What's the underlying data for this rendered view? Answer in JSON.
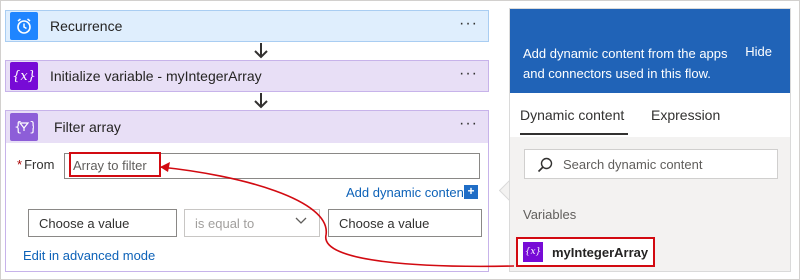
{
  "flow": {
    "recurrence_title": "Recurrence",
    "init_title": "Initialize variable - myIntegerArray",
    "filter_title": "Filter array",
    "more_label": "···",
    "from_label": "From",
    "required_mark": "*",
    "from_placeholder": "Array to filter",
    "add_dynamic_label": "Add dynamic content",
    "add_dynamic_plus": "+",
    "cond_left_placeholder": "Choose a value",
    "cond_operator": "is equal to",
    "cond_right_placeholder": "Choose a value",
    "advanced_mode_label": "Edit in advanced mode",
    "var_icon_glyph": "{x}"
  },
  "panel": {
    "description": "Add dynamic content from the apps and connectors used in this flow.",
    "hide_label": "Hide",
    "tabs": [
      {
        "label": "Dynamic content",
        "active": true
      },
      {
        "label": "Expression",
        "active": false
      }
    ],
    "search_placeholder": "Search dynamic content",
    "section_label": "Variables",
    "variable_name": "myIntegerArray",
    "variable_icon_glyph": "{x}"
  },
  "colors": {
    "recurrence_accent": "#1f85ff",
    "variable_accent": "#770bd6",
    "filter_accent": "#8d5ed8",
    "panel_header": "#2063b7",
    "highlight": "#d20a11",
    "link": "#0d62b8"
  },
  "icons": {
    "recurrence": "alarm-clock-icon",
    "variable": "variable-icon",
    "filter": "filter-icon",
    "search": "search-icon",
    "chevron": "chevron-down-icon"
  }
}
